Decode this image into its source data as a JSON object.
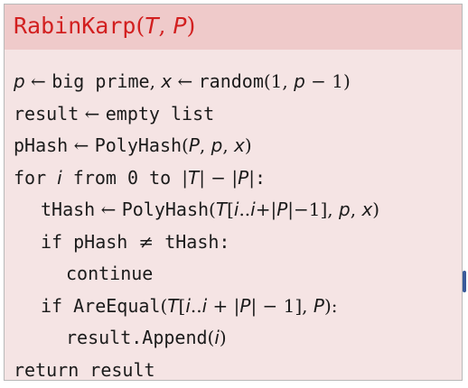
{
  "slide": {
    "title": {
      "name": "RabinKarp",
      "open": "(",
      "arg1": "T",
      "comma": ", ",
      "arg2": "P",
      "close": ")"
    },
    "lines": {
      "l1": {
        "p": "p",
        "arrow1": " ← ",
        "big_prime": "big prime",
        "comma": ", ",
        "x": "x",
        "arrow2": " ← ",
        "random": "random",
        "args": "(1, ",
        "p2": "p",
        "tail": " − 1)"
      },
      "l2": {
        "result": "result",
        "arrow": " ← ",
        "empty": "empty list"
      },
      "l3": {
        "phash": "pHash",
        "arrow": " ← ",
        "fn": "PolyHash",
        "open": "(",
        "P": "P",
        "c1": ", ",
        "p": "p",
        "c2": ", ",
        "x": "x",
        "close": ")"
      },
      "l4": {
        "for_kw": "for",
        "i": "i",
        "from_kw": "from",
        "zero": "0",
        "to_kw": "to",
        "bar1": "|",
        "T": "T",
        "mid": "| − |",
        "P": "P",
        "bar2": "|",
        "colon": ":"
      },
      "l5": {
        "thash": "tHash",
        "arrow": " ← ",
        "fn": "PolyHash",
        "open": "(",
        "T": "T",
        "lb": "[",
        "i1": "i",
        "dots": "..",
        "i2": "i",
        "plus": "+|",
        "P": "P",
        "minus": "|−1], ",
        "p": "p",
        "c": ", ",
        "x": "x",
        "close": ")"
      },
      "l6": {
        "if_kw": "if",
        "phash": "pHash",
        "neq": "≠",
        "thash": "tHash:"
      },
      "l7": {
        "continue_kw": "continue"
      },
      "l8": {
        "if_kw": "if",
        "fn": "AreEqual",
        "open": "(",
        "T": "T",
        "lb": "[",
        "i1": "i",
        "dots": "..",
        "i2": "i",
        "plus": " + |",
        "P": "P",
        "minus": "| − 1], ",
        "P2": "P",
        "close": "):"
      },
      "l9": {
        "call": "result.Append",
        "open": "(",
        "i": "i",
        "close": ")"
      },
      "l10": {
        "return_kw": "return",
        "result": "result"
      }
    }
  }
}
